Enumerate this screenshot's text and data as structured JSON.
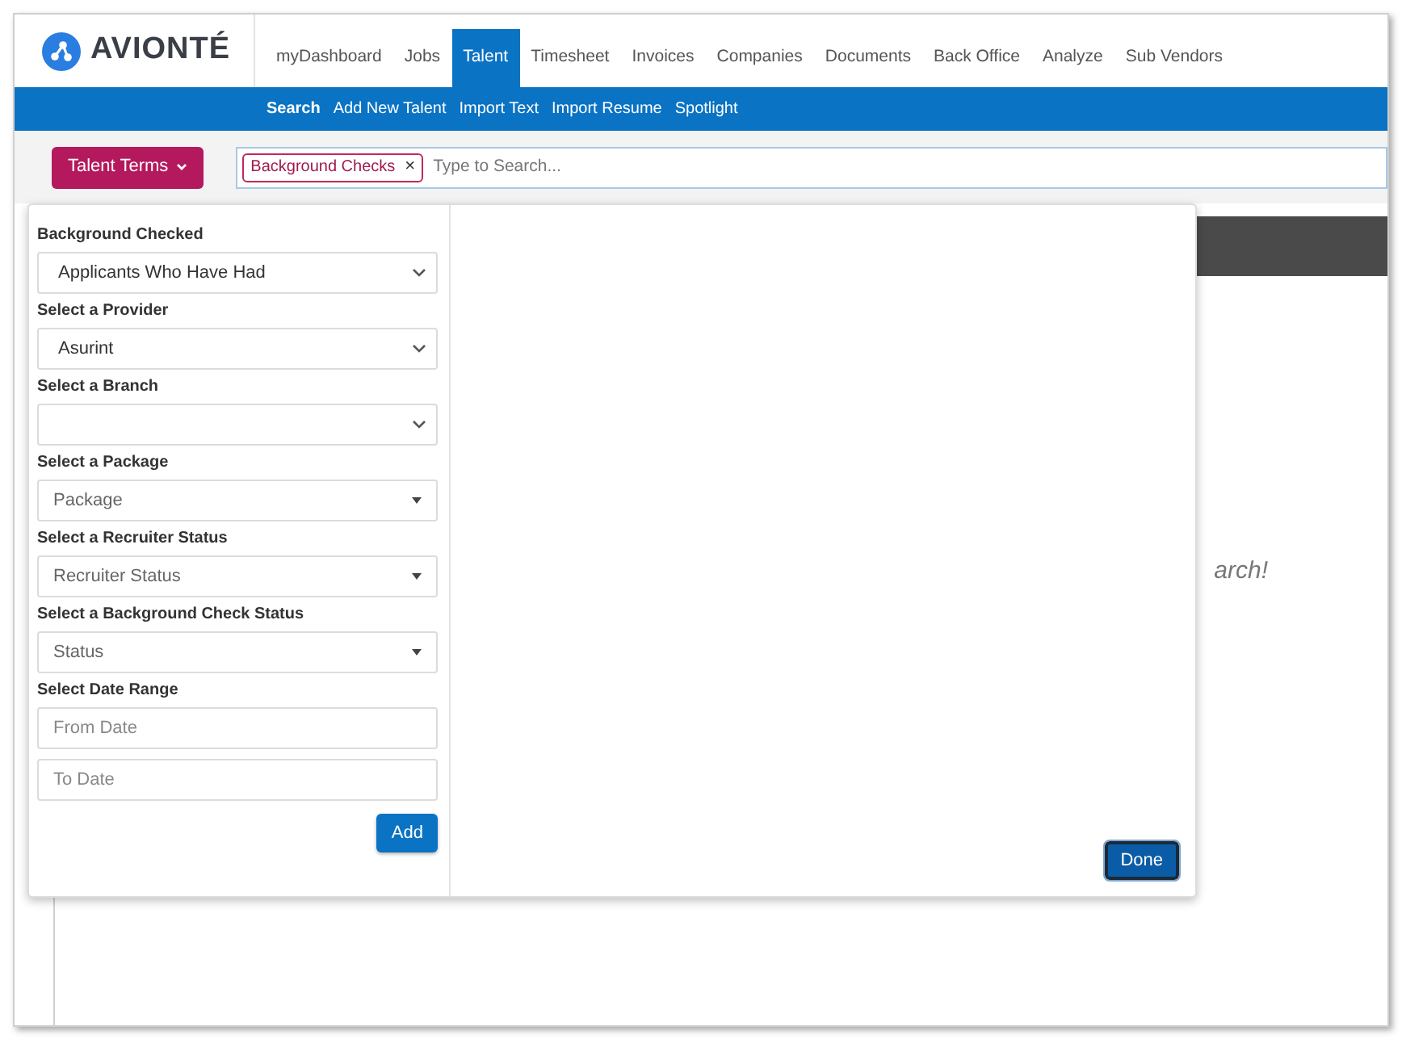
{
  "header": {
    "logo": "AVIONTÉ",
    "nav": [
      {
        "label": "myDashboard",
        "selected": false
      },
      {
        "label": "Jobs",
        "selected": false
      },
      {
        "label": "Talent",
        "selected": true
      },
      {
        "label": "Timesheet",
        "selected": false
      },
      {
        "label": "Invoices",
        "selected": false
      },
      {
        "label": "Companies",
        "selected": false
      },
      {
        "label": "Documents",
        "selected": false
      },
      {
        "label": "Back Office",
        "selected": false
      },
      {
        "label": "Analyze",
        "selected": false
      },
      {
        "label": "Sub Vendors",
        "selected": false
      }
    ]
  },
  "subnav": [
    {
      "label": "Search",
      "selected": true
    },
    {
      "label": "Add New Talent",
      "selected": false
    },
    {
      "label": "Import Text",
      "selected": false
    },
    {
      "label": "Import Resume",
      "selected": false
    },
    {
      "label": "Spotlight",
      "selected": false
    }
  ],
  "search_bar": {
    "terms_button": "Talent Terms",
    "tags": [
      {
        "label": "Background Checks",
        "remove": "×"
      }
    ],
    "placeholder": "Type to Search..."
  },
  "filter_panel": {
    "fields": [
      {
        "label": "Background Checked",
        "kind": "select",
        "value": "Applicants Who Have Had"
      },
      {
        "label": "Select a Provider",
        "kind": "select",
        "value": "Asurint"
      },
      {
        "label": "Select a Branch",
        "kind": "select"
      },
      {
        "label": "Select a Package",
        "kind": "dropdown",
        "placeholder": "Package"
      },
      {
        "label": "Select a Recruiter Status",
        "kind": "dropdown",
        "placeholder": "Recruiter Status"
      },
      {
        "label": "Select a Background Check Status",
        "kind": "dropdown",
        "placeholder": "Status"
      },
      {
        "label": "Select Date Range",
        "kind": "date",
        "placeholder": "From Date"
      },
      {
        "kind": "date",
        "placeholder": "To Date"
      }
    ],
    "add_button": "Add",
    "done_button": "Done"
  },
  "results": {
    "hint_text": "arch!"
  }
}
